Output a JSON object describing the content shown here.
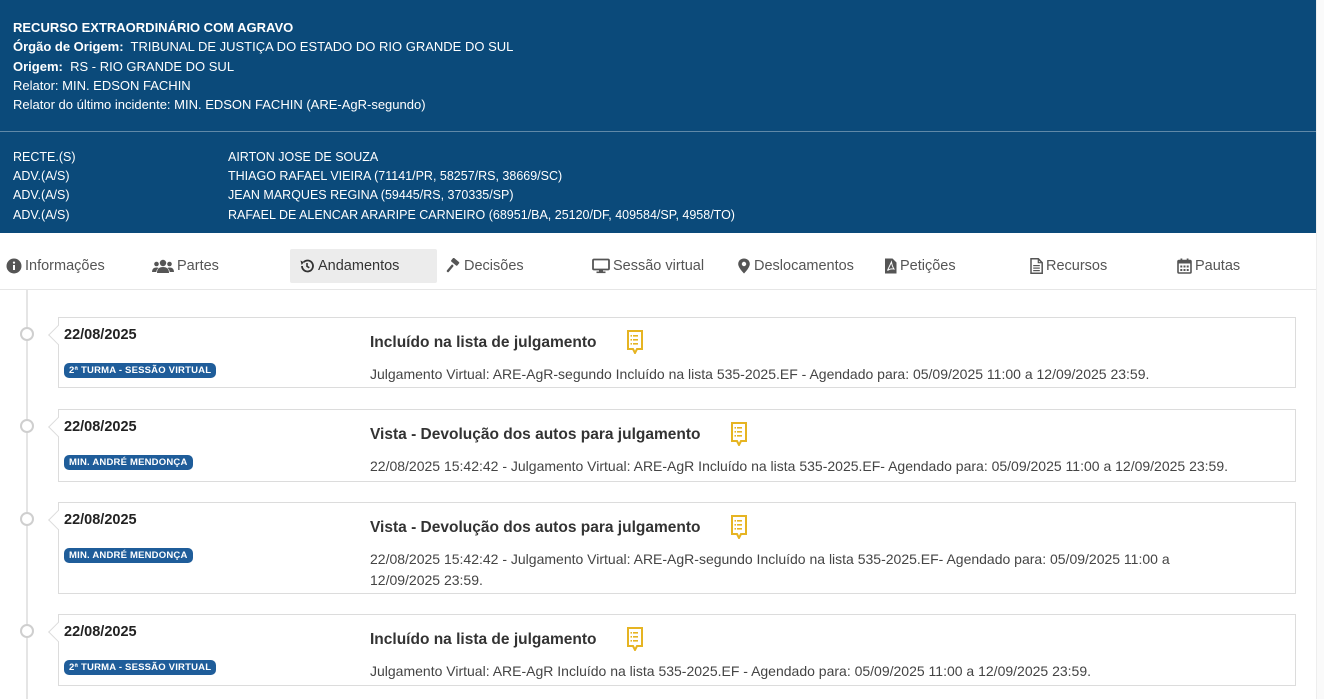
{
  "header": {
    "case_type": "RECURSO EXTRAORDINÁRIO COM AGRAVO",
    "orgao_label": "Órgão de Origem:",
    "orgao_value": "TRIBUNAL DE JUSTIÇA DO ESTADO DO RIO GRANDE DO SUL",
    "origem_label": "Origem:",
    "origem_value": "RS - RIO GRANDE DO SUL",
    "relator": "Relator: MIN. EDSON FACHIN",
    "relator_ultimo": "Relator do último incidente: MIN. EDSON FACHIN (ARE-AgR-segundo)",
    "parties": [
      {
        "role": "RECTE.(S)",
        "name": "AIRTON JOSE DE SOUZA"
      },
      {
        "role": "ADV.(A/S)",
        "name": "THIAGO RAFAEL VIEIRA (71141/PR, 58257/RS, 38669/SC)"
      },
      {
        "role": "ADV.(A/S)",
        "name": "JEAN MARQUES REGINA (59445/RS, 370335/SP)"
      },
      {
        "role": "ADV.(A/S)",
        "name": "RAFAEL DE ALENCAR ARARIPE CARNEIRO (68951/BA, 25120/DF, 409584/SP, 4958/TO)"
      }
    ]
  },
  "tabs": [
    {
      "label": "Informações",
      "icon": "info-icon"
    },
    {
      "label": "Partes",
      "icon": "users-icon"
    },
    {
      "label": "Andamentos",
      "icon": "history-icon",
      "active": true
    },
    {
      "label": "Decisões",
      "icon": "gavel-icon"
    },
    {
      "label": "Sessão virtual",
      "icon": "monitor-icon"
    },
    {
      "label": "Deslocamentos",
      "icon": "map-marker-icon"
    },
    {
      "label": "Petições",
      "icon": "pdf-file-icon"
    },
    {
      "label": "Recursos",
      "icon": "file-text-icon"
    },
    {
      "label": "Pautas",
      "icon": "calendar-icon"
    }
  ],
  "andamentos": [
    {
      "date": "22/08/2025",
      "badge": "2ª TURMA - SESSÃO VIRTUAL",
      "title": "Incluído na lista de julgamento",
      "description": "Julgamento Virtual: ARE-AgR-segundo Incluído na lista 535-2025.EF - Agendado para: 05/09/2025 11:00 a 12/09/2025 23:59."
    },
    {
      "date": "22/08/2025",
      "badge": "MIN. ANDRÉ MENDONÇA",
      "title": "Vista - Devolução dos autos para julgamento",
      "description": "22/08/2025 15:42:42 - Julgamento Virtual: ARE-AgR Incluído na lista 535-2025.EF- Agendado para: 05/09/2025 11:00 a 12/09/2025 23:59."
    },
    {
      "date": "22/08/2025",
      "badge": "MIN. ANDRÉ MENDONÇA",
      "title": "Vista - Devolução dos autos para julgamento",
      "description": "22/08/2025 15:42:42 - Julgamento Virtual: ARE-AgR-segundo Incluído na lista 535-2025.EF- Agendado para: 05/09/2025 11:00 a 12/09/2025 23:59."
    },
    {
      "date": "22/08/2025",
      "badge": "2ª TURMA - SESSÃO VIRTUAL",
      "title": "Incluído na lista de julgamento",
      "description": "Julgamento Virtual: ARE-AgR Incluído na lista 535-2025.EF - Agendado para: 05/09/2025 11:00 a 12/09/2025 23:59."
    }
  ],
  "colors": {
    "header_bg": "#0b4a7a",
    "badge_bg": "#1f5d9a",
    "doc_icon": "#e6b422"
  }
}
